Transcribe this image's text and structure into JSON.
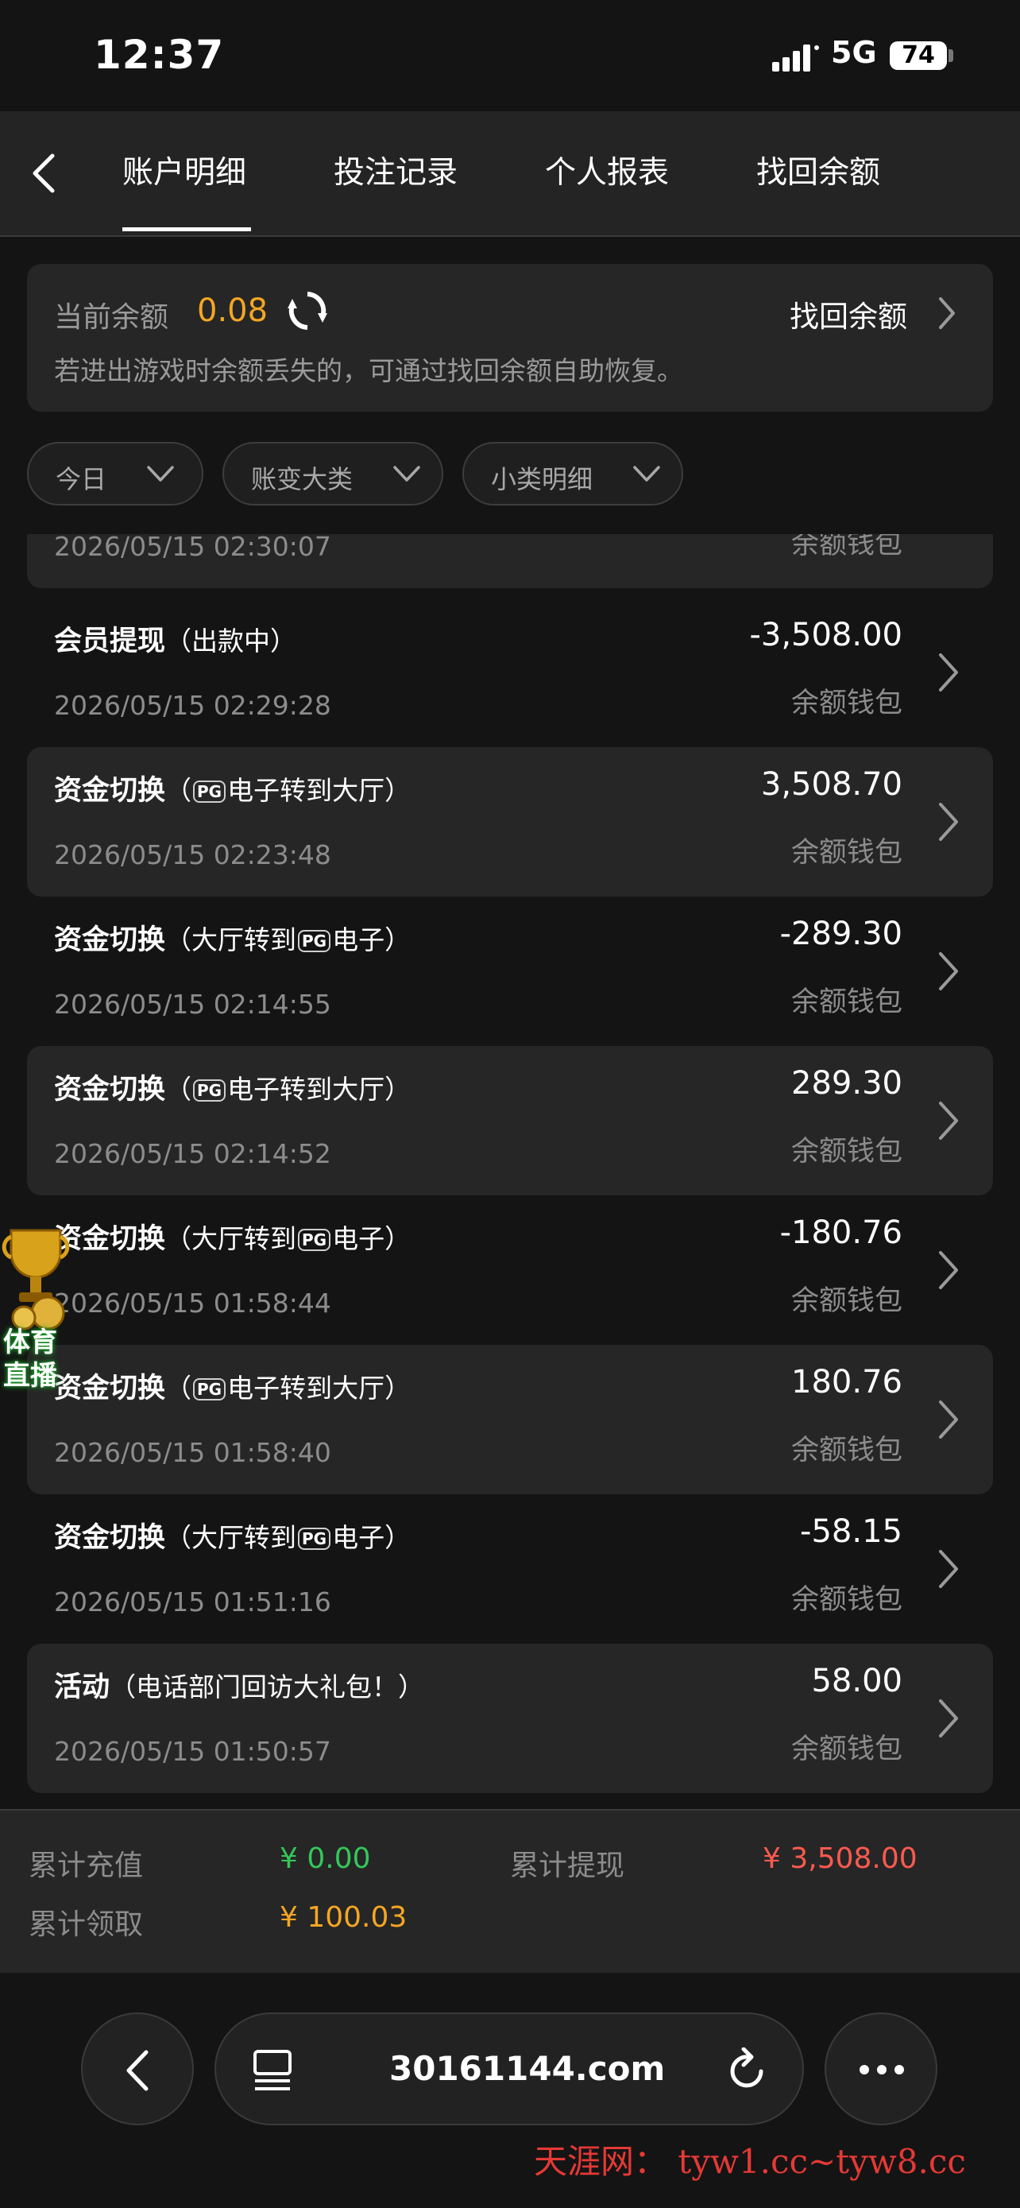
{
  "status_bar": {
    "time": "12:37",
    "network": "5G",
    "battery": "74"
  },
  "nav": {
    "tabs": [
      {
        "label": "账户明细",
        "active": true
      },
      {
        "label": "投注记录",
        "active": false
      },
      {
        "label": "个人报表",
        "active": false
      },
      {
        "label": "找回余额",
        "active": false
      }
    ]
  },
  "balance": {
    "label": "当前余额",
    "amount": "0.08",
    "recover_link": "找回余额",
    "hint": "若进出游戏时余额丢失的，可通过找回余额自助恢复。"
  },
  "filters": [
    {
      "label": "今日"
    },
    {
      "label": "账变大类"
    },
    {
      "label": "小类明细"
    }
  ],
  "records": [
    {
      "title": "",
      "sub": "",
      "date": "2026/05/15 02:30:07",
      "amount": "",
      "wallet": "余额钱包",
      "shaded": true
    },
    {
      "title": "会员提现",
      "sub": "（出款中）",
      "date": "2026/05/15 02:29:28",
      "amount": "-3,508.00",
      "wallet": "余额钱包",
      "shaded": false
    },
    {
      "title": "资金切换",
      "sub_pre": "（",
      "pg_first": true,
      "sub_post": "电子转到大厅）",
      "date": "2026/05/15 02:23:48",
      "amount": "3,508.70",
      "wallet": "余额钱包",
      "shaded": true
    },
    {
      "title": "资金切换",
      "sub_pre": "（大厅转到",
      "pg_first": false,
      "sub_post": "电子）",
      "date": "2026/05/15 02:14:55",
      "amount": "-289.30",
      "wallet": "余额钱包",
      "shaded": false
    },
    {
      "title": "资金切换",
      "sub_pre": "（",
      "pg_first": true,
      "sub_post": "电子转到大厅）",
      "date": "2026/05/15 02:14:52",
      "amount": "289.30",
      "wallet": "余额钱包",
      "shaded": true
    },
    {
      "title": "资金切换",
      "sub_pre": "（大厅转到",
      "pg_first": false,
      "sub_post": "电子）",
      "date": "2026/05/15 01:58:44",
      "amount": "-180.76",
      "wallet": "余额钱包",
      "shaded": false
    },
    {
      "title": "资金切换",
      "sub_pre": "（",
      "pg_first": true,
      "sub_post": "电子转到大厅）",
      "date": "2026/05/15 01:58:40",
      "amount": "180.76",
      "wallet": "余额钱包",
      "shaded": true
    },
    {
      "title": "资金切换",
      "sub_pre": "（大厅转到",
      "pg_first": false,
      "sub_post": "电子）",
      "date": "2026/05/15 01:51:16",
      "amount": "-58.15",
      "wallet": "余额钱包",
      "shaded": false
    },
    {
      "title": "活动",
      "sub": "（电话部门回访大礼包！）",
      "date": "2026/05/15 01:50:57",
      "amount": "58.00",
      "wallet": "余额钱包",
      "shaded": true
    }
  ],
  "pg_logo_text": "PG",
  "floating_badge": {
    "line1": "体育",
    "line2": "直播"
  },
  "summary": {
    "recharge_label": "累计充值",
    "recharge_value": "¥ 0.00",
    "withdraw_label": "累计提现",
    "withdraw_value": "¥ 3,508.00",
    "claim_label": "累计领取",
    "claim_value": "¥ 100.03"
  },
  "browser": {
    "url": "30161144.com"
  },
  "watermark": "天涯网： tyw1.cc~tyw8.cc",
  "colors": {
    "accent": "#f5a623",
    "green": "#34c759",
    "red": "#ff5a4f"
  }
}
